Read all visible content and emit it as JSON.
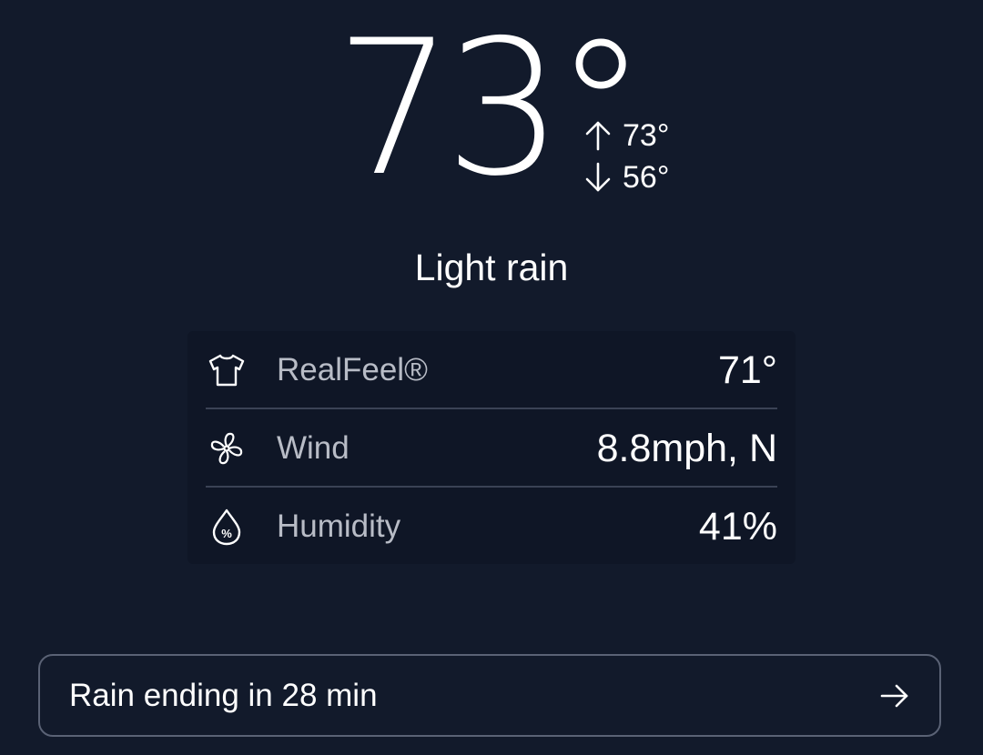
{
  "current": {
    "temperature": "73°",
    "high": "73°",
    "low": "56°",
    "condition": "Light rain"
  },
  "details": [
    {
      "icon": "shirt-icon",
      "label": "RealFeel®",
      "value": "71°"
    },
    {
      "icon": "fan-icon",
      "label": "Wind",
      "value": "8.8mph, N"
    },
    {
      "icon": "humidity-drop-icon",
      "label": "Humidity",
      "value": "41%"
    }
  ],
  "minutecast": {
    "label": "Rain ending in 28 min",
    "icon": "arrow-right-icon"
  },
  "colors": {
    "background": "#121a2b",
    "card": "#0f1626",
    "text": "#ffffff",
    "muted_text": "#b8bcc6"
  }
}
